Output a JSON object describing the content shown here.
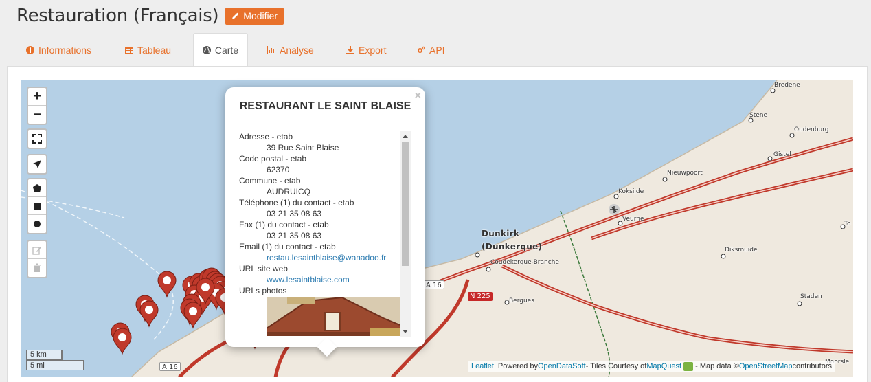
{
  "header": {
    "title": "Restauration (Français)",
    "edit_label": "Modifier"
  },
  "tabs": [
    {
      "label": "Informations",
      "icon": "info-circle-icon"
    },
    {
      "label": "Tableau",
      "icon": "table-icon"
    },
    {
      "label": "Carte",
      "icon": "globe-icon",
      "active": true
    },
    {
      "label": "Analyse",
      "icon": "bar-chart-icon"
    },
    {
      "label": "Export",
      "icon": "download-icon"
    },
    {
      "label": "API",
      "icon": "cogs-icon"
    }
  ],
  "map_controls": {
    "zoom_in": "+",
    "zoom_out": "−"
  },
  "popup": {
    "title": "RESTAURANT LE SAINT BLAISE",
    "close": "×",
    "fields": [
      {
        "label": "Adresse - etab",
        "value": "39 Rue Saint Blaise"
      },
      {
        "label": "Code postal - etab",
        "value": "62370"
      },
      {
        "label": "Commune - etab",
        "value": "AUDRUICQ"
      },
      {
        "label": "Téléphone (1) du contact - etab",
        "value": "03 21 35 08 63"
      },
      {
        "label": "Fax (1) du contact - etab",
        "value": "03 21 35 08 63"
      },
      {
        "label": "Email (1) du contact - etab",
        "value": "restau.lesaintblaise@wanadoo.fr",
        "link": true
      },
      {
        "label": "URL site web",
        "value": "www.lesaintblaise.com",
        "link": true
      },
      {
        "label": "URLs photos",
        "value": ""
      }
    ]
  },
  "places": [
    {
      "name": "Bredene"
    },
    {
      "name": "Stene"
    },
    {
      "name": "Oudenburg"
    },
    {
      "name": "Gistel"
    },
    {
      "name": "Nieuwpoort"
    },
    {
      "name": "Koksijde"
    },
    {
      "name": "Veurne"
    },
    {
      "name": "Dunkirk"
    },
    {
      "name": "(Dunkerque)"
    },
    {
      "name": "Coudekerque-Branche"
    },
    {
      "name": "Bergues"
    },
    {
      "name": "Diksmuide"
    },
    {
      "name": "Staden"
    },
    {
      "name": "Moorsle"
    },
    {
      "name": "To"
    }
  ],
  "roads": {
    "a16_right": "A 16",
    "n225": "N 225",
    "a16_bottom": "A 16"
  },
  "scale": {
    "km": "5 km",
    "mi": "5 mi"
  },
  "attribution": {
    "leaflet": "Leaflet",
    "powered": " | Powered by ",
    "ods": "OpenDataSoft",
    "tiles": " - Tiles Courtesy of ",
    "mapquest": "MapQuest",
    "mapdata": " - Map data © ",
    "osm": "OpenStreetMap",
    "contrib": " contributors"
  },
  "colors": {
    "accent": "#e8712b",
    "marker": "#c0392b",
    "sea": "#b5d0e6",
    "land": "#efe9df",
    "road": "#c0392b"
  }
}
